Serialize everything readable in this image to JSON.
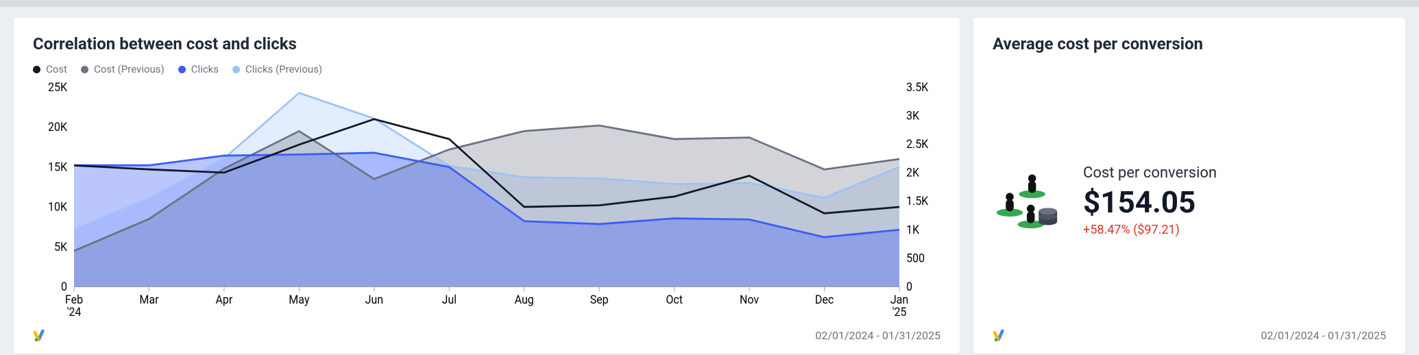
{
  "chart_card": {
    "title": "Correlation between cost and clicks",
    "legend": [
      "Cost",
      "Cost (Previous)",
      "Clicks",
      "Clicks (Previous)"
    ],
    "date_range": "02/01/2024 - 01/31/2025"
  },
  "kpi_card": {
    "title": "Average cost per conversion",
    "label": "Cost per conversion",
    "value": "$154.05",
    "delta": "+58.47% ($97.21)",
    "date_range": "02/01/2024 - 01/31/2025"
  },
  "chart_data": {
    "type": "line",
    "categories": [
      "Feb '24",
      "Mar",
      "Apr",
      "May",
      "Jun",
      "Jul",
      "Aug",
      "Sep",
      "Oct",
      "Nov",
      "Dec",
      "Jan '25"
    ],
    "left_axis": {
      "label": "",
      "range": [
        0,
        25000
      ],
      "ticks": [
        0,
        5000,
        10000,
        15000,
        20000,
        25000
      ],
      "tick_labels": [
        "0",
        "5K",
        "10K",
        "15K",
        "20K",
        "25K"
      ]
    },
    "right_axis": {
      "label": "",
      "range": [
        0,
        3500
      ],
      "ticks": [
        0,
        500,
        1000,
        1500,
        2000,
        2500,
        3000,
        3500
      ],
      "tick_labels": [
        "0",
        "500",
        "1K",
        "1.5K",
        "2K",
        "2.5K",
        "3K",
        "3.5K"
      ]
    },
    "series": [
      {
        "name": "Cost",
        "axis": "left",
        "color": "#111827",
        "values": [
          15200,
          14700,
          14300,
          17800,
          21000,
          18500,
          10000,
          10200,
          11300,
          13900,
          9200,
          10000
        ]
      },
      {
        "name": "Cost (Previous)",
        "axis": "left",
        "color": "#6b7280",
        "values": [
          4500,
          8500,
          14800,
          19500,
          13500,
          17200,
          19500,
          20200,
          18500,
          18700,
          14700,
          16000
        ]
      },
      {
        "name": "Clicks",
        "axis": "right",
        "color": "#3b5bfd",
        "values": [
          2130,
          2130,
          2300,
          2320,
          2350,
          2100,
          1150,
          1100,
          1200,
          1180,
          870,
          1000
        ]
      },
      {
        "name": "Clicks (Previous)",
        "axis": "right",
        "color": "#9ec2f7",
        "values": [
          1000,
          1550,
          2250,
          3400,
          2950,
          2120,
          1920,
          1900,
          1800,
          1820,
          1560,
          2100
        ]
      }
    ],
    "title": "Correlation between cost and clicks"
  }
}
